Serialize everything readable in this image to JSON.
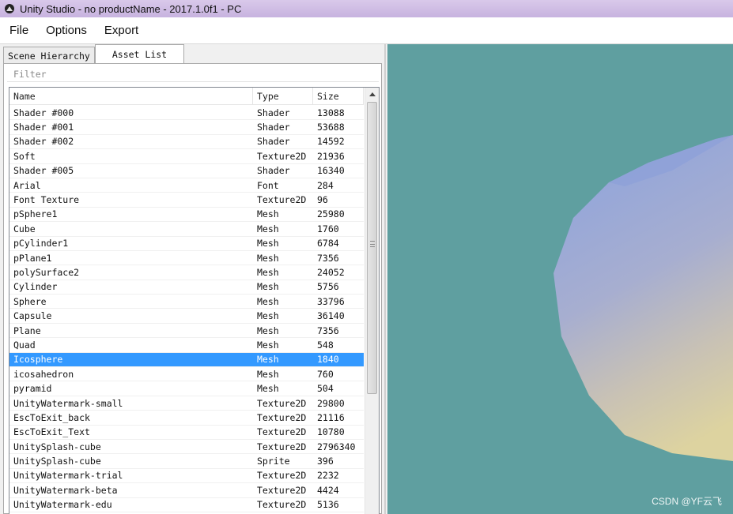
{
  "window": {
    "title": "Unity Studio - no productName - 2017.1.0f1 - PC",
    "icon": "unity-icon"
  },
  "menu": {
    "items": [
      "File",
      "Options",
      "Export"
    ]
  },
  "tabs": [
    {
      "label": "Scene Hierarchy",
      "active": false
    },
    {
      "label": "Asset List",
      "active": true
    }
  ],
  "filter": {
    "placeholder": "Filter",
    "value": ""
  },
  "asset_list": {
    "columns": [
      "Name",
      "Type",
      "Size"
    ],
    "selected_index": 17,
    "rows": [
      {
        "name": "Shader #000",
        "type": "Shader",
        "size": "13088"
      },
      {
        "name": "Shader #001",
        "type": "Shader",
        "size": "53688"
      },
      {
        "name": "Shader #002",
        "type": "Shader",
        "size": "14592"
      },
      {
        "name": "Soft",
        "type": "Texture2D",
        "size": "21936"
      },
      {
        "name": "Shader #005",
        "type": "Shader",
        "size": "16340"
      },
      {
        "name": "Arial",
        "type": "Font",
        "size": "284"
      },
      {
        "name": "Font Texture",
        "type": "Texture2D",
        "size": "96"
      },
      {
        "name": "pSphere1",
        "type": "Mesh",
        "size": "25980"
      },
      {
        "name": "Cube",
        "type": "Mesh",
        "size": "1760"
      },
      {
        "name": "pCylinder1",
        "type": "Mesh",
        "size": "6784"
      },
      {
        "name": "pPlane1",
        "type": "Mesh",
        "size": "7356"
      },
      {
        "name": "polySurface2",
        "type": "Mesh",
        "size": "24052"
      },
      {
        "name": "Cylinder",
        "type": "Mesh",
        "size": "5756"
      },
      {
        "name": "Sphere",
        "type": "Mesh",
        "size": "33796"
      },
      {
        "name": "Capsule",
        "type": "Mesh",
        "size": "36140"
      },
      {
        "name": "Plane",
        "type": "Mesh",
        "size": "7356"
      },
      {
        "name": "Quad",
        "type": "Mesh",
        "size": "548"
      },
      {
        "name": "Icosphere",
        "type": "Mesh",
        "size": "1840"
      },
      {
        "name": "icosahedron",
        "type": "Mesh",
        "size": "760"
      },
      {
        "name": "pyramid",
        "type": "Mesh",
        "size": "504"
      },
      {
        "name": "UnityWatermark-small",
        "type": "Texture2D",
        "size": "29800"
      },
      {
        "name": "EscToExit_back",
        "type": "Texture2D",
        "size": "21116"
      },
      {
        "name": "EscToExit_Text",
        "type": "Texture2D",
        "size": "10780"
      },
      {
        "name": "UnitySplash-cube",
        "type": "Texture2D",
        "size": "2796340"
      },
      {
        "name": "UnitySplash-cube",
        "type": "Sprite",
        "size": "396"
      },
      {
        "name": "UnityWatermark-trial",
        "type": "Texture2D",
        "size": "2232"
      },
      {
        "name": "UnityWatermark-beta",
        "type": "Texture2D",
        "size": "4424"
      },
      {
        "name": "UnityWatermark-edu",
        "type": "Texture2D",
        "size": "5136"
      }
    ]
  },
  "viewport": {
    "background": "#5f9fa0",
    "watermark": "CSDN @YF云飞"
  },
  "colors": {
    "selection": "#3399ff",
    "title_bar": "#c9b6e0"
  }
}
